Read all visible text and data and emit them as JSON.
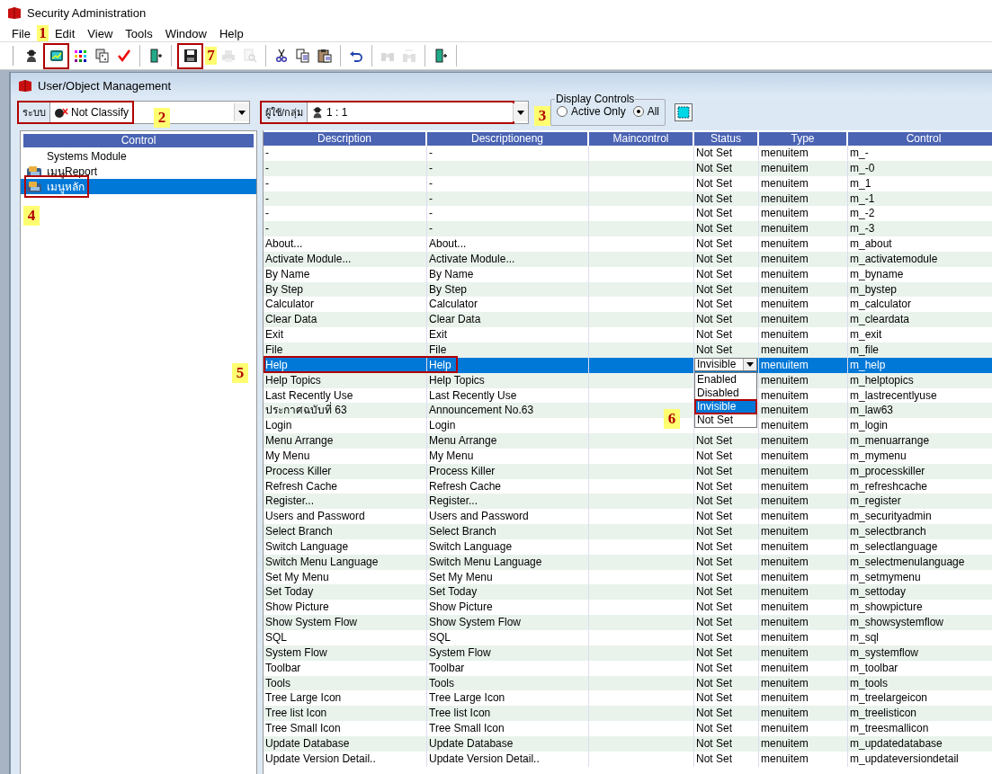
{
  "window": {
    "title": "Security Administration"
  },
  "menu": [
    "File",
    "Edit",
    "View",
    "Tools",
    "Window",
    "Help"
  ],
  "toolbar": [
    {
      "kind": "button",
      "disabled": false,
      "outlined": false
    },
    {
      "kind": "button",
      "disabled": false,
      "outlined": true
    },
    {
      "kind": "button",
      "disabled": false,
      "outlined": false
    },
    {
      "kind": "button",
      "disabled": false,
      "outlined": false
    },
    {
      "kind": "button",
      "disabled": false,
      "outlined": false
    },
    {
      "kind": "separator"
    },
    {
      "kind": "button",
      "disabled": false,
      "outlined": false
    },
    {
      "kind": "separator"
    },
    {
      "kind": "button",
      "disabled": false,
      "outlined": true
    },
    {
      "kind": "button",
      "disabled": true,
      "outlined": false
    },
    {
      "kind": "button",
      "disabled": true,
      "outlined": false
    },
    {
      "kind": "separator"
    },
    {
      "kind": "button",
      "disabled": false,
      "outlined": false
    },
    {
      "kind": "button",
      "disabled": false,
      "outlined": false
    },
    {
      "kind": "button",
      "disabled": false,
      "outlined": false
    },
    {
      "kind": "separator"
    },
    {
      "kind": "button",
      "disabled": false,
      "outlined": false
    },
    {
      "kind": "separator"
    },
    {
      "kind": "button",
      "disabled": true,
      "outlined": false
    },
    {
      "kind": "button",
      "disabled": true,
      "outlined": false
    },
    {
      "kind": "separator"
    },
    {
      "kind": "button",
      "disabled": false,
      "outlined": false
    },
    {
      "kind": "separator"
    }
  ],
  "child_window": {
    "title": "User/Object Management"
  },
  "system_combo": {
    "label": "ระบบ",
    "value": "Not Classify",
    "outlined": true
  },
  "user_combo": {
    "label": "ผู้ใช้/กลุ่ม",
    "value": "1 : 1",
    "outlined": true
  },
  "display_controls": {
    "title": "Display Controls",
    "options": [
      {
        "label": "Active Only",
        "selected": false
      },
      {
        "label": "All",
        "selected": true
      }
    ]
  },
  "tree": {
    "header": "Control",
    "items": [
      {
        "label": "Systems Module",
        "kind": "plain",
        "selected": false,
        "outlined": false
      },
      {
        "label": "เมนูReport",
        "kind": "module",
        "selected": false,
        "outlined": false
      },
      {
        "label": "เมนูหลัก",
        "kind": "module",
        "selected": true,
        "outlined": true
      }
    ]
  },
  "table": {
    "columns": [
      "Description",
      "Descriptioneng",
      "Maincontrol",
      "Status",
      "Type",
      "Control"
    ],
    "rows": [
      {
        "description": "-",
        "descriptioneng": "-",
        "status": "Not Set",
        "type": "menuitem",
        "control": "m_-",
        "selected": false,
        "outlined": false
      },
      {
        "description": "-",
        "descriptioneng": "-",
        "status": "Not Set",
        "type": "menuitem",
        "control": "m_-0",
        "selected": false,
        "outlined": false
      },
      {
        "description": "-",
        "descriptioneng": "-",
        "status": "Not Set",
        "type": "menuitem",
        "control": "m_1",
        "selected": false,
        "outlined": false
      },
      {
        "description": "-",
        "descriptioneng": "-",
        "status": "Not Set",
        "type": "menuitem",
        "control": "m_-1",
        "selected": false,
        "outlined": false
      },
      {
        "description": "-",
        "descriptioneng": "-",
        "status": "Not Set",
        "type": "menuitem",
        "control": "m_-2",
        "selected": false,
        "outlined": false
      },
      {
        "description": "-",
        "descriptioneng": "-",
        "status": "Not Set",
        "type": "menuitem",
        "control": "m_-3",
        "selected": false,
        "outlined": false
      },
      {
        "description": "About...",
        "descriptioneng": "About...",
        "status": "Not Set",
        "type": "menuitem",
        "control": "m_about",
        "selected": false,
        "outlined": false
      },
      {
        "description": "Activate Module...",
        "descriptioneng": "Activate Module...",
        "status": "Not Set",
        "type": "menuitem",
        "control": "m_activatemodule",
        "selected": false,
        "outlined": false
      },
      {
        "description": "By Name",
        "descriptioneng": "By Name",
        "status": "Not Set",
        "type": "menuitem",
        "control": "m_byname",
        "selected": false,
        "outlined": false
      },
      {
        "description": "By Step",
        "descriptioneng": "By Step",
        "status": "Not Set",
        "type": "menuitem",
        "control": "m_bystep",
        "selected": false,
        "outlined": false
      },
      {
        "description": "Calculator",
        "descriptioneng": "Calculator",
        "status": "Not Set",
        "type": "menuitem",
        "control": "m_calculator",
        "selected": false,
        "outlined": false
      },
      {
        "description": "Clear Data",
        "descriptioneng": "Clear Data",
        "status": "Not Set",
        "type": "menuitem",
        "control": "m_cleardata",
        "selected": false,
        "outlined": false
      },
      {
        "description": "Exit",
        "descriptioneng": "Exit",
        "status": "Not Set",
        "type": "menuitem",
        "control": "m_exit",
        "selected": false,
        "outlined": false
      },
      {
        "description": "File",
        "descriptioneng": "File",
        "status": "Not Set",
        "type": "menuitem",
        "control": "m_file",
        "selected": false,
        "outlined": false
      },
      {
        "description": "Help",
        "descriptioneng": "Help",
        "status_dropdown": {
          "value": "Invisible",
          "options": [
            {
              "label": "Enabled",
              "selected": false,
              "outlined": false
            },
            {
              "label": "Disabled",
              "selected": false,
              "outlined": false
            },
            {
              "label": "Invisible",
              "selected": true,
              "outlined": true
            },
            {
              "label": "Not Set",
              "selected": false,
              "outlined": false
            }
          ]
        },
        "type": "menuitem",
        "control": "m_help",
        "selected": true,
        "outlined": true
      },
      {
        "description": "Help Topics",
        "descriptioneng": "Help Topics",
        "type": "menuitem",
        "control": "m_helptopics",
        "selected": false,
        "outlined": false
      },
      {
        "description": "Last Recently Use",
        "descriptioneng": "Last Recently Use",
        "type": "menuitem",
        "control": "m_lastrecentlyuse",
        "selected": false,
        "outlined": false
      },
      {
        "description": "ประกาศฉบับที่ 63",
        "descriptioneng": "Announcement No.63",
        "type": "menuitem",
        "control": "m_law63",
        "selected": false,
        "outlined": false
      },
      {
        "description": "Login",
        "descriptioneng": "Login",
        "type": "menuitem",
        "control": "m_login",
        "selected": false,
        "outlined": false
      },
      {
        "description": "Menu Arrange",
        "descriptioneng": "Menu Arrange",
        "status": "Not Set",
        "type": "menuitem",
        "control": "m_menuarrange",
        "selected": false,
        "outlined": false
      },
      {
        "description": "My Menu",
        "descriptioneng": "My Menu",
        "status": "Not Set",
        "type": "menuitem",
        "control": "m_mymenu",
        "selected": false,
        "outlined": false
      },
      {
        "description": "Process Killer",
        "descriptioneng": "Process Killer",
        "status": "Not Set",
        "type": "menuitem",
        "control": "m_processkiller",
        "selected": false,
        "outlined": false
      },
      {
        "description": "Refresh Cache",
        "descriptioneng": "Refresh Cache",
        "status": "Not Set",
        "type": "menuitem",
        "control": "m_refreshcache",
        "selected": false,
        "outlined": false
      },
      {
        "description": "Register...",
        "descriptioneng": "Register...",
        "status": "Not Set",
        "type": "menuitem",
        "control": "m_register",
        "selected": false,
        "outlined": false
      },
      {
        "description": "Users and Password",
        "descriptioneng": "Users and Password",
        "status": "Not Set",
        "type": "menuitem",
        "control": "m_securityadmin",
        "selected": false,
        "outlined": false
      },
      {
        "description": "Select Branch",
        "descriptioneng": "Select Branch",
        "status": "Not Set",
        "type": "menuitem",
        "control": "m_selectbranch",
        "selected": false,
        "outlined": false
      },
      {
        "description": "Switch Language",
        "descriptioneng": "Switch Language",
        "status": "Not Set",
        "type": "menuitem",
        "control": "m_selectlanguage",
        "selected": false,
        "outlined": false
      },
      {
        "description": "Switch Menu Language",
        "descriptioneng": "Switch Menu Language",
        "status": "Not Set",
        "type": "menuitem",
        "control": "m_selectmenulanguage",
        "selected": false,
        "outlined": false
      },
      {
        "description": "Set My Menu",
        "descriptioneng": "Set My Menu",
        "status": "Not Set",
        "type": "menuitem",
        "control": "m_setmymenu",
        "selected": false,
        "outlined": false
      },
      {
        "description": "Set Today",
        "descriptioneng": "Set Today",
        "status": "Not Set",
        "type": "menuitem",
        "control": "m_settoday",
        "selected": false,
        "outlined": false
      },
      {
        "description": "Show Picture",
        "descriptioneng": "Show Picture",
        "status": "Not Set",
        "type": "menuitem",
        "control": "m_showpicture",
        "selected": false,
        "outlined": false
      },
      {
        "description": "Show System Flow",
        "descriptioneng": "Show System Flow",
        "status": "Not Set",
        "type": "menuitem",
        "control": "m_showsystemflow",
        "selected": false,
        "outlined": false
      },
      {
        "description": "SQL",
        "descriptioneng": "SQL",
        "status": "Not Set",
        "type": "menuitem",
        "control": "m_sql",
        "selected": false,
        "outlined": false
      },
      {
        "description": "System Flow",
        "descriptioneng": "System Flow",
        "status": "Not Set",
        "type": "menuitem",
        "control": "m_systemflow",
        "selected": false,
        "outlined": false
      },
      {
        "description": "Toolbar",
        "descriptioneng": "Toolbar",
        "status": "Not Set",
        "type": "menuitem",
        "control": "m_toolbar",
        "selected": false,
        "outlined": false
      },
      {
        "description": "Tools",
        "descriptioneng": "Tools",
        "status": "Not Set",
        "type": "menuitem",
        "control": "m_tools",
        "selected": false,
        "outlined": false
      },
      {
        "description": "Tree Large Icon",
        "descriptioneng": "Tree Large Icon",
        "status": "Not Set",
        "type": "menuitem",
        "control": "m_treelargeicon",
        "selected": false,
        "outlined": false
      },
      {
        "description": "Tree list Icon",
        "descriptioneng": "Tree list Icon",
        "status": "Not Set",
        "type": "menuitem",
        "control": "m_treelisticon",
        "selected": false,
        "outlined": false
      },
      {
        "description": "Tree Small Icon",
        "descriptioneng": "Tree Small Icon",
        "status": "Not Set",
        "type": "menuitem",
        "control": "m_treesmallicon",
        "selected": false,
        "outlined": false
      },
      {
        "description": "Update Database",
        "descriptioneng": "Update Database",
        "status": "Not Set",
        "type": "menuitem",
        "control": "m_updatedatabase",
        "selected": false,
        "outlined": false
      },
      {
        "description": "Update Version Detail..",
        "descriptioneng": "Update Version Detail..",
        "status": "Not Set",
        "type": "menuitem",
        "control": "m_updateversiondetail",
        "selected": false,
        "outlined": false
      }
    ]
  },
  "annotations": [
    {
      "label": "1"
    },
    {
      "label": "2"
    },
    {
      "label": "3"
    },
    {
      "label": "4"
    },
    {
      "label": "5"
    },
    {
      "label": "6"
    },
    {
      "label": "7"
    }
  ]
}
